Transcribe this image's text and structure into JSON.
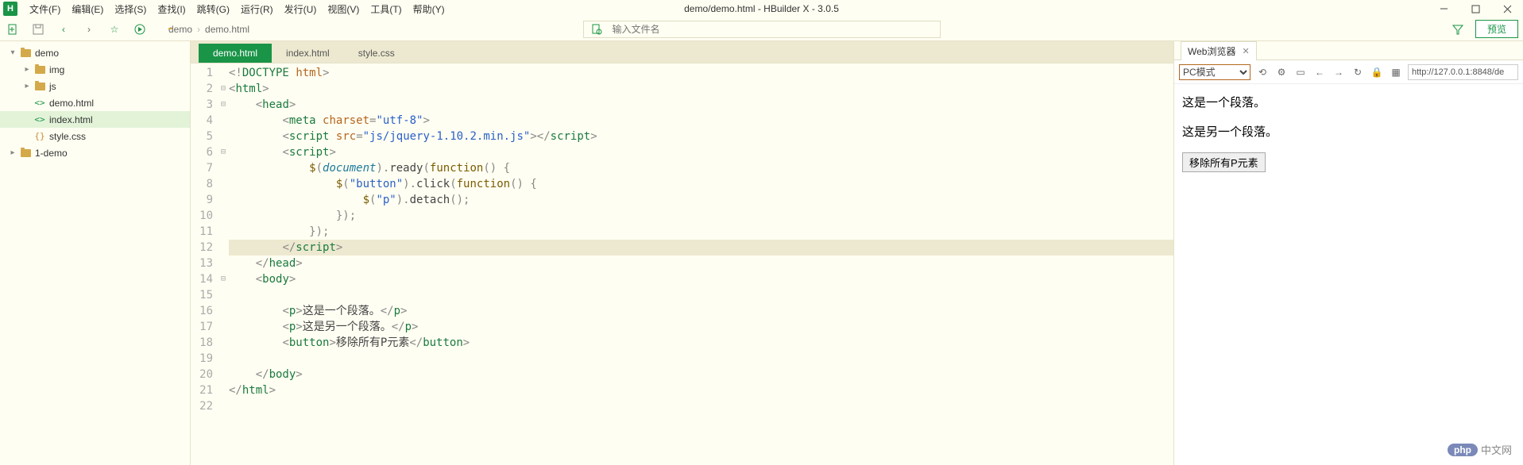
{
  "window": {
    "title": "demo/demo.html - HBuilder X - 3.0.5",
    "logo": "H"
  },
  "menu": [
    "文件(F)",
    "编辑(E)",
    "选择(S)",
    "查找(I)",
    "跳转(G)",
    "运行(R)",
    "发行(U)",
    "视图(V)",
    "工具(T)",
    "帮助(Y)"
  ],
  "toolbar": {
    "breadcrumb": [
      "demo",
      "demo.html"
    ],
    "search_placeholder": "输入文件名",
    "preview_label": "预览"
  },
  "filetree": [
    {
      "indent": 0,
      "twisty": "▾",
      "type": "folder",
      "label": "demo"
    },
    {
      "indent": 1,
      "twisty": "▸",
      "type": "folder",
      "label": "img"
    },
    {
      "indent": 1,
      "twisty": "▸",
      "type": "folder",
      "label": "js"
    },
    {
      "indent": 1,
      "twisty": "",
      "type": "html",
      "label": "demo.html"
    },
    {
      "indent": 1,
      "twisty": "",
      "type": "html",
      "label": "index.html",
      "selected": true
    },
    {
      "indent": 1,
      "twisty": "",
      "type": "css",
      "label": "style.css"
    },
    {
      "indent": 0,
      "twisty": "▸",
      "type": "folder",
      "label": "1-demo"
    }
  ],
  "editor": {
    "tabs": [
      {
        "label": "demo.html",
        "active": true
      },
      {
        "label": "index.html",
        "active": false
      },
      {
        "label": "style.css",
        "active": false
      }
    ],
    "highlight_line": 12,
    "lines": [
      {
        "n": 1,
        "fold": "",
        "html": "<span class='c-op'>&lt;!</span><span class='c-tag'>DOCTYPE</span> <span class='c-attr'>html</span><span class='c-op'>&gt;</span>"
      },
      {
        "n": 2,
        "fold": "⊟",
        "html": "<span class='c-op'>&lt;</span><span class='c-tag'>html</span><span class='c-op'>&gt;</span>"
      },
      {
        "n": 3,
        "fold": "⊟",
        "html": "    <span class='c-op'>&lt;</span><span class='c-tag'>head</span><span class='c-op'>&gt;</span>"
      },
      {
        "n": 4,
        "fold": "",
        "html": "        <span class='c-op'>&lt;</span><span class='c-tag'>meta</span> <span class='c-attr'>charset</span><span class='c-op'>=</span><span class='c-str'>\"utf-8\"</span><span class='c-op'>&gt;</span>"
      },
      {
        "n": 5,
        "fold": "",
        "html": "        <span class='c-op'>&lt;</span><span class='c-tag'>script</span> <span class='c-attr'>src</span><span class='c-op'>=</span><span class='c-str'>\"js/jquery-1.10.2.min.js\"</span><span class='c-op'>&gt;&lt;/</span><span class='c-tag'>script</span><span class='c-op'>&gt;</span>"
      },
      {
        "n": 6,
        "fold": "⊟",
        "html": "        <span class='c-op'>&lt;</span><span class='c-tag'>script</span><span class='c-op'>&gt;</span>"
      },
      {
        "n": 7,
        "fold": "",
        "html": "            <span class='c-kw'>$</span><span class='c-op'>(</span><span class='c-var'>document</span><span class='c-op'>).</span><span class='c-plain'>ready</span><span class='c-op'>(</span><span class='c-kw'>function</span><span class='c-op'>() {</span>"
      },
      {
        "n": 8,
        "fold": "",
        "html": "                <span class='c-kw'>$</span><span class='c-op'>(</span><span class='c-str'>\"button\"</span><span class='c-op'>).</span><span class='c-plain'>click</span><span class='c-op'>(</span><span class='c-kw'>function</span><span class='c-op'>() {</span>"
      },
      {
        "n": 9,
        "fold": "",
        "html": "                    <span class='c-kw'>$</span><span class='c-op'>(</span><span class='c-str'>\"p\"</span><span class='c-op'>).</span><span class='c-plain'>detach</span><span class='c-op'>();</span>"
      },
      {
        "n": 10,
        "fold": "",
        "html": "                <span class='c-op'>});</span>"
      },
      {
        "n": 11,
        "fold": "",
        "html": "            <span class='c-op'>});</span>"
      },
      {
        "n": 12,
        "fold": "",
        "html": "        <span class='c-op'>&lt;/</span><span class='c-tag'>script</span><span class='c-op'>&gt;</span>"
      },
      {
        "n": 13,
        "fold": "",
        "html": "    <span class='c-op'>&lt;/</span><span class='c-tag'>head</span><span class='c-op'>&gt;</span>"
      },
      {
        "n": 14,
        "fold": "⊟",
        "html": "    <span class='c-op'>&lt;</span><span class='c-tag'>body</span><span class='c-op'>&gt;</span>"
      },
      {
        "n": 15,
        "fold": "",
        "html": ""
      },
      {
        "n": 16,
        "fold": "",
        "html": "        <span class='c-op'>&lt;</span><span class='c-tag'>p</span><span class='c-op'>&gt;</span><span class='c-plain'>这是一个段落。</span><span class='c-op'>&lt;/</span><span class='c-tag'>p</span><span class='c-op'>&gt;</span>"
      },
      {
        "n": 17,
        "fold": "",
        "html": "        <span class='c-op'>&lt;</span><span class='c-tag'>p</span><span class='c-op'>&gt;</span><span class='c-plain'>这是另一个段落。</span><span class='c-op'>&lt;/</span><span class='c-tag'>p</span><span class='c-op'>&gt;</span>"
      },
      {
        "n": 18,
        "fold": "",
        "html": "        <span class='c-op'>&lt;</span><span class='c-tag'>button</span><span class='c-op'>&gt;</span><span class='c-plain'>移除所有P元素</span><span class='c-op'>&lt;/</span><span class='c-tag'>button</span><span class='c-op'>&gt;</span>"
      },
      {
        "n": 19,
        "fold": "",
        "html": ""
      },
      {
        "n": 20,
        "fold": "",
        "html": "    <span class='c-op'>&lt;/</span><span class='c-tag'>body</span><span class='c-op'>&gt;</span>"
      },
      {
        "n": 21,
        "fold": "",
        "html": "<span class='c-op'>&lt;/</span><span class='c-tag'>html</span><span class='c-op'>&gt;</span>"
      },
      {
        "n": 22,
        "fold": "",
        "html": ""
      }
    ]
  },
  "browser": {
    "tab_label": "Web浏览器",
    "mode": "PC模式",
    "url": "http://127.0.0.1:8848/de",
    "p1": "这是一个段落。",
    "p2": "这是另一个段落。",
    "button": "移除所有P元素"
  },
  "watermark": {
    "php": "php",
    "text": "中文网"
  }
}
